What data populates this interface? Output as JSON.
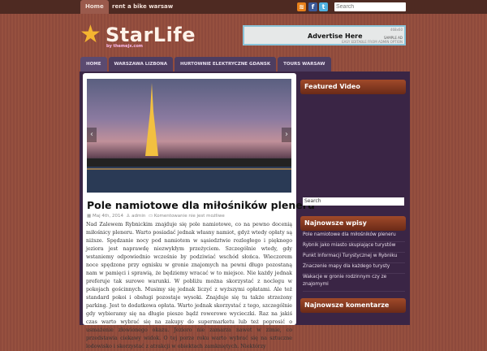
{
  "topnav": {
    "items": [
      "Home",
      "rent a bike warsaw"
    ],
    "search_placeholder": "Search"
  },
  "social": [
    "rss-icon",
    "facebook-icon",
    "twitter-icon"
  ],
  "logo": {
    "title": "StarLife",
    "subtitle": "by themejx.com"
  },
  "ad": {
    "size": "468x60",
    "title": "Advertise Here",
    "sample": "SAMPLE AD",
    "note": "EASY EDITABLE FROM ADMIN OPTION"
  },
  "nav": [
    "HOME",
    "WARSZAWA LIZBONA",
    "HURTOWNIE ELEKTRYCZNE GDANSK",
    "TOURS WARSAW"
  ],
  "post": {
    "title": "Pole namiotowe dla miłośników pleneru",
    "date": "Maj 4th, 2014",
    "author": "admin",
    "comments": "Komentowanie nie jest możliwe",
    "body": "Nad Zalewem Rybnickim znajduje się pole namiotowe, co na pewno docenią miłośnicy pleneru. Warto posiadać jednak własny namiot, gdyż wtedy opłaty są niższe. Spędzanie nocy pod namiotem w sąsiedztwie rozległego i pięknego jeziora jest naprawdę niezwykłym przeżyciem. Szczególnie wtedy, gdy wstaniemy odpowiednio wcześnie by podziwiać wschód słońca. Wieczorem noce spędzone przy ognisku w gronie znajomych na pewni długo pozostaną nam w pamięci i sprawią, że będziemy wracać w to miejsce. Nie każdy jednak preferuje tak surowe warunki. W pobliżu można skorzystać z noclegu w pokojach gościnnych. Musimy się jednak liczyć z wyższymi opłatami. Ale też standard pokoi i obsługi pozostaje wysoki. Znajduje się tu także strzeżony parking. Jest to dodatkowa opłata. Warto jednak skorzystać z tego, szczególnie gdy wybieramy się na długie piesze bądź rowerowe wycieczki. Raz na jakiś czas warto wybrać się na zakupy do supermarketu lub też poprosić o usmażenie złowionego okazu. Jezioro nie zamarza nawet w zimie, co przedstawia ciekawy widok. O tej porze roku warto wybrać się na sztuczne lodowisko i skorzystać z atrakcji w obiektach zamkniętych. Niektórzy"
  },
  "sidebar": {
    "featured_video": "Featured Video",
    "search_placeholder": "Search",
    "recent_title": "Najnowsze wpisy",
    "recent": [
      "Pole namiotowe dla miłośników pleneru",
      "Rybnik jako miasto skupiające turystów",
      "Punkt Informacji Turystycznej w Rybniku",
      "Znaczenie mapy dla każdego turysty",
      "Wakacje w gronie rodzinnym czy ze znajomymi"
    ],
    "comments_title": "Najnowsze komentarze"
  }
}
